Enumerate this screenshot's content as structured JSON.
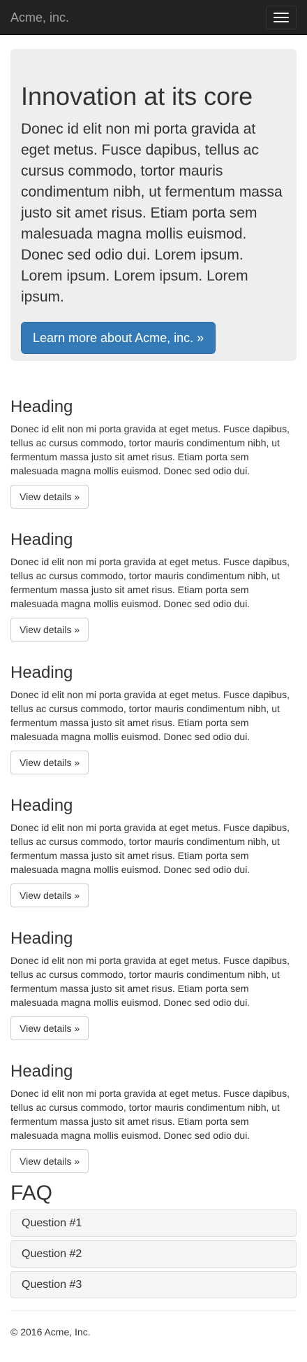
{
  "navbar": {
    "brand": "Acme, inc.",
    "toggle_icon": "hamburger-menu-icon"
  },
  "jumbotron": {
    "title": "Innovation at its core",
    "lead": "Donec id elit non mi porta gravida at eget metus. Fusce dapibus, tellus ac cursus commodo, tortor mauris condimentum nibh, ut fermentum massa justo sit amet risus. Etiam porta sem malesuada magna mollis euismod. Donec sed odio dui. Lorem ipsum. Lorem ipsum. Lorem ipsum. Lorem ipsum.",
    "button_label": "Learn more about Acme, inc. »"
  },
  "features": [
    {
      "heading": "Heading",
      "body": "Donec id elit non mi porta gravida at eget metus. Fusce dapibus, tellus ac cursus commodo, tortor mauris condimentum nibh, ut fermentum massa justo sit amet risus. Etiam porta sem malesuada magna mollis euismod. Donec sed odio dui.",
      "button_label": "View details »"
    },
    {
      "heading": "Heading",
      "body": "Donec id elit non mi porta gravida at eget metus. Fusce dapibus, tellus ac cursus commodo, tortor mauris condimentum nibh, ut fermentum massa justo sit amet risus. Etiam porta sem malesuada magna mollis euismod. Donec sed odio dui.",
      "button_label": "View details »"
    },
    {
      "heading": "Heading",
      "body": "Donec id elit non mi porta gravida at eget metus. Fusce dapibus, tellus ac cursus commodo, tortor mauris condimentum nibh, ut fermentum massa justo sit amet risus. Etiam porta sem malesuada magna mollis euismod. Donec sed odio dui.",
      "button_label": "View details »"
    },
    {
      "heading": "Heading",
      "body": "Donec id elit non mi porta gravida at eget metus. Fusce dapibus, tellus ac cursus commodo, tortor mauris condimentum nibh, ut fermentum massa justo sit amet risus. Etiam porta sem malesuada magna mollis euismod. Donec sed odio dui.",
      "button_label": "View details »"
    },
    {
      "heading": "Heading",
      "body": "Donec id elit non mi porta gravida at eget metus. Fusce dapibus, tellus ac cursus commodo, tortor mauris condimentum nibh, ut fermentum massa justo sit amet risus. Etiam porta sem malesuada magna mollis euismod. Donec sed odio dui.",
      "button_label": "View details »"
    },
    {
      "heading": "Heading",
      "body": "Donec id elit non mi porta gravida at eget metus. Fusce dapibus, tellus ac cursus commodo, tortor mauris condimentum nibh, ut fermentum massa justo sit amet risus. Etiam porta sem malesuada magna mollis euismod. Donec sed odio dui.",
      "button_label": "View details »"
    }
  ],
  "faq": {
    "title": "FAQ",
    "questions": [
      "Question #1",
      "Question #2",
      "Question #3"
    ]
  },
  "footer": {
    "text": "© 2016 Acme, Inc."
  },
  "colors": {
    "navbar_bg": "#222222",
    "brand_text": "#9d9d9d",
    "jumbotron_bg": "#eeeeee",
    "primary": "#337ab7",
    "text": "#333333",
    "panel_bg": "#f5f5f5"
  }
}
